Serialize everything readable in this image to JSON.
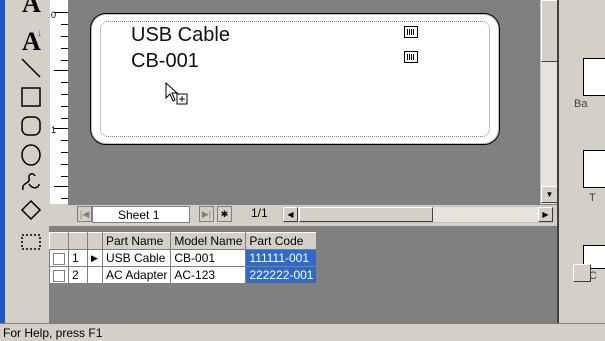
{
  "toolbox": {
    "tools": [
      "text-tool-icon",
      "vertical-text-tool-icon",
      "line-tool-icon",
      "rectangle-tool-icon",
      "rounded-rectangle-tool-icon",
      "ellipse-tool-icon",
      "freehand-tool-icon",
      "polygon-tool-icon",
      "select-area-tool-icon"
    ],
    "text_letter": "A",
    "vtext_letter": "A"
  },
  "ruler": {
    "labels": [
      "0",
      "1"
    ]
  },
  "label": {
    "line1": "USB Cable",
    "line2": "CB-001"
  },
  "sheet": {
    "tab_label": "Sheet 1",
    "count": "1/1"
  },
  "grid": {
    "headers": [
      "",
      "",
      "",
      "Part Name",
      "Model Name",
      "Part Code"
    ],
    "rows": [
      {
        "num": "1",
        "current": true,
        "part_name": "USB Cable",
        "model": "CB-001",
        "code": "111111-001"
      },
      {
        "num": "2",
        "current": false,
        "part_name": "AC Adapter",
        "model": "AC-123",
        "code": "222222-001"
      }
    ]
  },
  "right_panel": {
    "label1": "Ba",
    "label2": "T",
    "label3": "C"
  },
  "status": {
    "text": "For Help, press F1"
  },
  "colors": {
    "selection": "#316ac5",
    "accent": "#1e58c8"
  }
}
